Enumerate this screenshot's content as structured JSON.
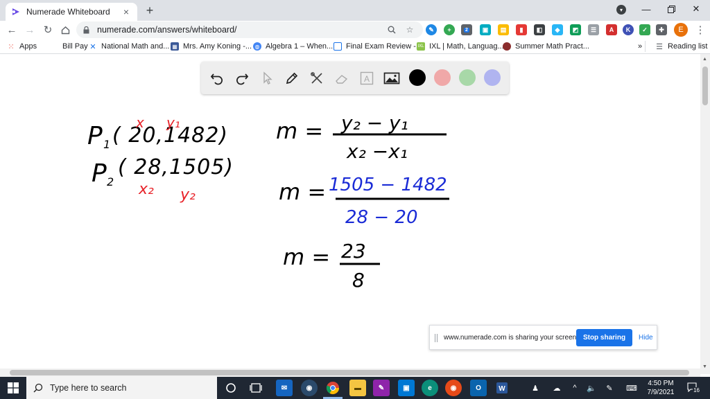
{
  "browser": {
    "tab_title": "Numerade Whiteboard",
    "tab_close": "×",
    "new_tab": "+",
    "url": "numerade.com/answers/whiteboard/",
    "profile_badge": "2",
    "avatar_letter": "E"
  },
  "bookmarks": [
    {
      "label": "Apps",
      "color": "#ea4335"
    },
    {
      "label": "Bill Pay",
      "color": "#ffffff"
    },
    {
      "label": "National Math and...",
      "color": "#1a73e8"
    },
    {
      "label": "Mrs. Amy Koning -...",
      "color": "#3b5998"
    },
    {
      "label": "Algebra 1 – When...",
      "color": "#4285f4"
    },
    {
      "label": "Final Exam Review -...",
      "color": "#1a73e8"
    },
    {
      "label": "IXL | Math, Languag...",
      "color": "#8bc34a"
    },
    {
      "label": "Summer Math Pract...",
      "color": "#8b2d2d"
    }
  ],
  "bookmarks_more": "»",
  "reading_list": "Reading list",
  "whiteboard": {
    "colors": [
      "#000000",
      "#f0a8a8",
      "#a8d8a8",
      "#b0b4f0"
    ],
    "selected_color": "#000000"
  },
  "handwriting": {
    "p1_label": "P",
    "p1_sub": "1",
    "p1_coords": "( 20,1482)",
    "p1_x_note": "x",
    "p1_y_note": "y₁",
    "p2_label": "P",
    "p2_sub": "2",
    "p2_coords": "( 28,1505)",
    "p2_x_note": "x₂",
    "p2_y_note": "y₂",
    "formula_lhs": "m =",
    "formula_num": "y₂ − y₁",
    "formula_den": "x₂ −x₁",
    "sub_lhs": "m =",
    "sub_num": "1505  − 1482",
    "sub_den": "28  − 20",
    "result_lhs": "m =",
    "result_num": "23",
    "result_den": "8",
    "colors": {
      "ink": "#000000",
      "red": "#e8232a",
      "blue": "#1a2bd6"
    }
  },
  "share_bar": {
    "message": "www.numerade.com is sharing your screen.",
    "stop_label": "Stop sharing",
    "hide_label": "Hide"
  },
  "taskbar": {
    "search_placeholder": "Type here to search",
    "time": "4:50 PM",
    "date": "7/9/2021",
    "notifications": "16"
  }
}
